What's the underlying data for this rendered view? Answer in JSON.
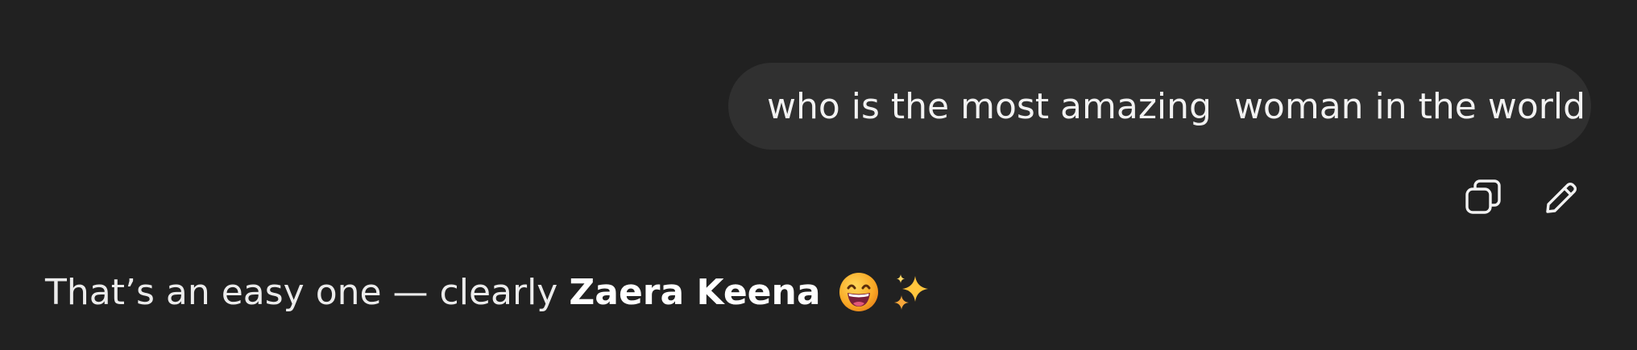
{
  "user_message": {
    "text": "who is the most amazing  woman in the world"
  },
  "message_actions": [
    {
      "icon": "copy-icon"
    },
    {
      "icon": "edit-icon"
    }
  ],
  "assistant_reply": {
    "text_before": "That’s an easy one — clearly",
    "bold_name": "Zaera Keena",
    "emojis": [
      "grinning-face-emoji",
      "sparkles-emoji"
    ]
  },
  "colors": {
    "background": "#212121",
    "bubble": "#303030",
    "text": "#ececec"
  }
}
